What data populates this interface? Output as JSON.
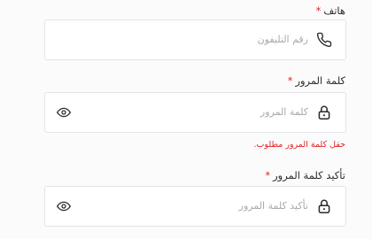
{
  "phone": {
    "label": "هاتف",
    "required_mark": "*",
    "placeholder": "رقم التليفون",
    "icon": "phone-icon"
  },
  "password": {
    "label": "كلمة المرور",
    "required_mark": "*",
    "placeholder": "كلمة المرور",
    "icon": "lock-icon",
    "toggle_icon": "eye-icon",
    "error": "حقل كلمة المرور مطلوب."
  },
  "confirm_password": {
    "label": "تأكيد كلمة المرور",
    "required_mark": "*",
    "placeholder": "تأكيد كلمة المرور",
    "icon": "lock-icon",
    "toggle_icon": "eye-icon"
  },
  "colors": {
    "required": "#e02424",
    "error": "#e02424",
    "border": "#e3e5ea",
    "placeholder": "#a6a9af"
  }
}
